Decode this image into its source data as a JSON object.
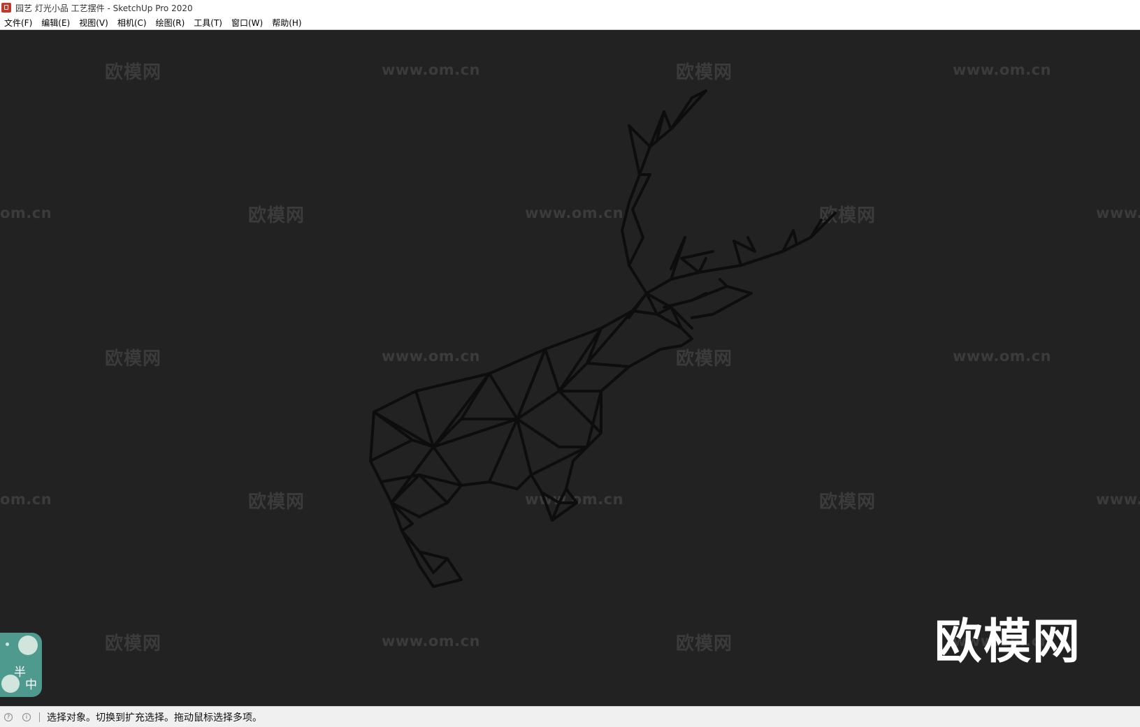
{
  "window": {
    "title": "园艺 灯光小品 工艺摆件 - SketchUp Pro 2020",
    "app_icon": "sketchup-icon"
  },
  "menu": [
    {
      "label": "文件(F)"
    },
    {
      "label": "编辑(E)"
    },
    {
      "label": "视图(V)"
    },
    {
      "label": "相机(C)"
    },
    {
      "label": "绘图(R)"
    },
    {
      "label": "工具(T)"
    },
    {
      "label": "窗口(W)"
    },
    {
      "label": "帮助(H)"
    }
  ],
  "watermarks": {
    "brand": "欧模网",
    "url": "www.om.cn",
    "url_partial_left": "om.cn",
    "url_partial_right": "www."
  },
  "logo_text": "欧模网",
  "sticker": {
    "chars": [
      "半",
      "中"
    ]
  },
  "status": {
    "message": "选择对象。切换到扩充选择。拖动鼠标选择多项。",
    "icons": [
      "geo-location-icon",
      "info-icon"
    ]
  },
  "colors": {
    "viewport_bg": "#222222",
    "model_lines": "#0d0d0d",
    "watermark": "#3b3b3b"
  }
}
